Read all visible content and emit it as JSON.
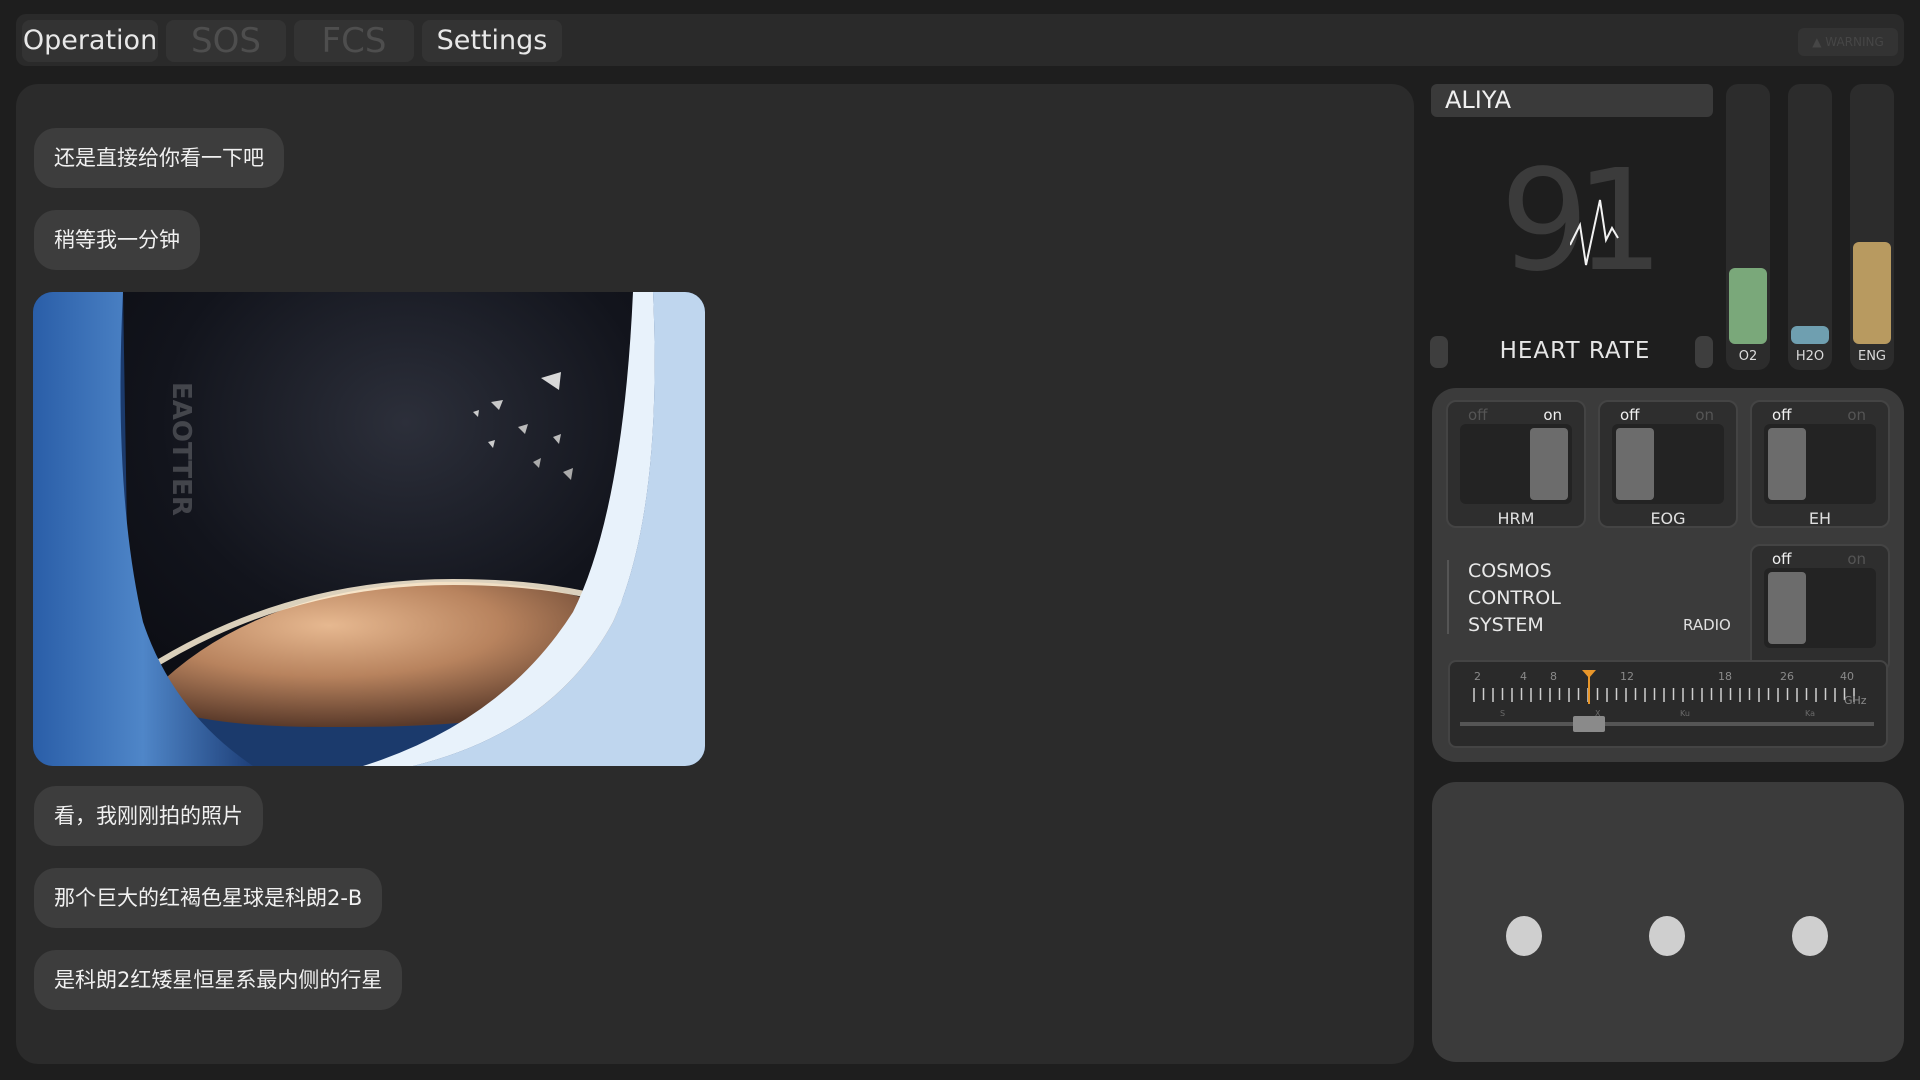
{
  "tabs": [
    {
      "label": "Operation",
      "state": "active"
    },
    {
      "label": "SOS",
      "state": "disabled"
    },
    {
      "label": "FCS",
      "state": "disabled"
    },
    {
      "label": "Settings",
      "state": "active"
    }
  ],
  "warning_button": "WARNING",
  "chat": {
    "messages": [
      "还是直接给你看一下吧",
      "稍等我一分钟",
      "看，我刚刚拍的照片",
      "那个巨大的红褐色星球是科朗2-B",
      "是科朗2红矮星恒星系最内侧的行星"
    ],
    "photo_caption": "EAOTTER"
  },
  "vitals": {
    "name": "ALIYA",
    "heart_rate_value": "91",
    "heart_rate_label": "HEART RATE",
    "gauges": [
      {
        "label": "O2",
        "level": 0.3,
        "color": "#7aa87a"
      },
      {
        "label": "H2O",
        "level": 0.07,
        "color": "#6f9fb0"
      },
      {
        "label": "ENG",
        "level": 0.4,
        "color": "#b89a60"
      }
    ]
  },
  "switches": [
    {
      "name": "HRM",
      "state": "on",
      "off_label": "off",
      "on_label": "on"
    },
    {
      "name": "EOG",
      "state": "off",
      "off_label": "off",
      "on_label": "on"
    },
    {
      "name": "EH",
      "state": "off",
      "off_label": "off",
      "on_label": "on"
    }
  ],
  "control": {
    "title_lines": [
      "COSMOS",
      "CONTROL",
      "SYSTEM"
    ],
    "radio_label": "RADIO",
    "radio_switch": {
      "state": "off",
      "off_label": "off",
      "on_label": "on"
    },
    "tuner": {
      "ticks": [
        "2",
        "4",
        "8",
        "12",
        "18",
        "26",
        "40"
      ],
      "unit": "GHz",
      "bands": [
        "S",
        "X",
        "Ku",
        "Ka"
      ],
      "value_ghz": 10
    }
  },
  "colors": {
    "accent": "#e8962a"
  }
}
